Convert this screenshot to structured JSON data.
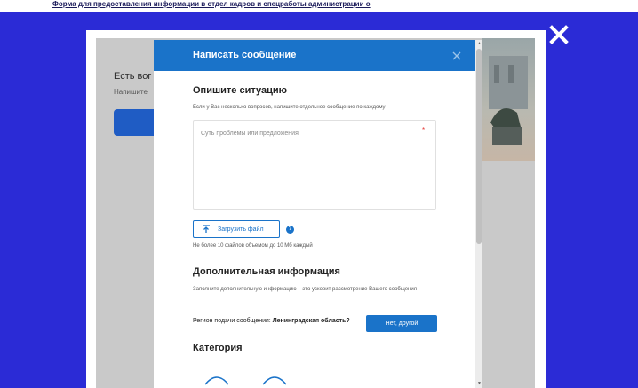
{
  "page": {
    "top_link": "Форма для предоставления информации в отдел кадров и спецработы администрации о"
  },
  "background_page": {
    "heading": "Есть вог",
    "subtext": "Напишите"
  },
  "modal": {
    "title": "Написать сообщение",
    "situation": {
      "title": "Опишите ситуацию",
      "hint": "Если у Вас несколько вопросов, напишите отдельное сообщение по каждому",
      "textarea_placeholder": "Суть проблемы или предложения",
      "required_mark": "*"
    },
    "upload": {
      "button_label": "Загрузить файл",
      "help": "?",
      "limit_note": "Не более 10 файлов объемом до 10 Мб каждый"
    },
    "additional": {
      "title": "Дополнительная информация",
      "hint": "Заполните дополнительную информацию – это ускорит рассмотрение Вашего сообщения"
    },
    "region": {
      "label": "Регион подачи сообщения:",
      "value": "Ленинградская область?",
      "other_button": "Нет, другой"
    },
    "category": {
      "title": "Категория"
    }
  },
  "colors": {
    "overlay": "#2b2bd6",
    "accent": "#1a73c9",
    "required": "#e53935"
  },
  "icons": [
    "close-icon",
    "upload-icon",
    "help-icon",
    "chevron-up-icon"
  ]
}
